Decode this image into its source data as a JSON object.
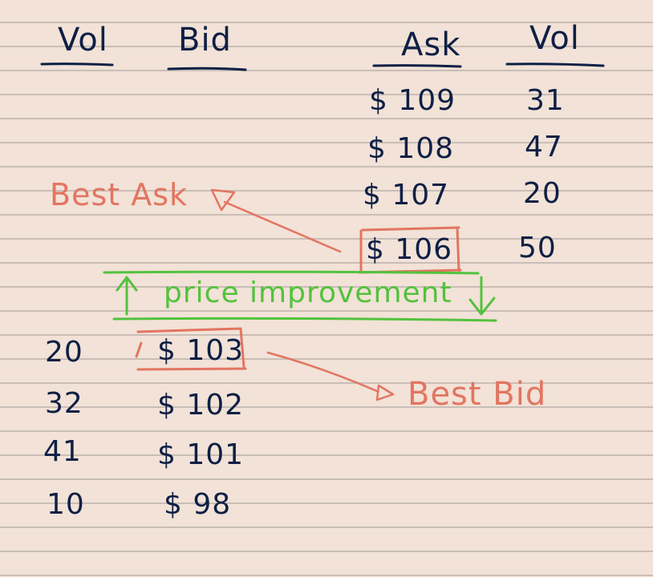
{
  "headers": {
    "bid_vol": "Vol",
    "bid": "Bid",
    "ask": "Ask",
    "ask_vol": "Vol"
  },
  "asks": [
    {
      "price": "$ 109",
      "vol": "31"
    },
    {
      "price": "$ 108",
      "vol": "47"
    },
    {
      "price": "$ 107",
      "vol": "20"
    },
    {
      "price": "$ 106",
      "vol": "50"
    }
  ],
  "bids": [
    {
      "vol": "20",
      "price": "$ 103"
    },
    {
      "vol": "32",
      "price": "$ 102"
    },
    {
      "vol": "41",
      "price": "$ 101"
    },
    {
      "vol": "10",
      "price": "$ 98"
    }
  ],
  "annotations": {
    "best_ask": "Best Ask",
    "best_bid": "Best Bid",
    "spread": "price improvement"
  },
  "colors": {
    "ink": "#0e1f45",
    "highlight": "#e27561",
    "spread": "#53c23d",
    "paper": "#f2e2d7",
    "rule": "#c9beb7"
  }
}
